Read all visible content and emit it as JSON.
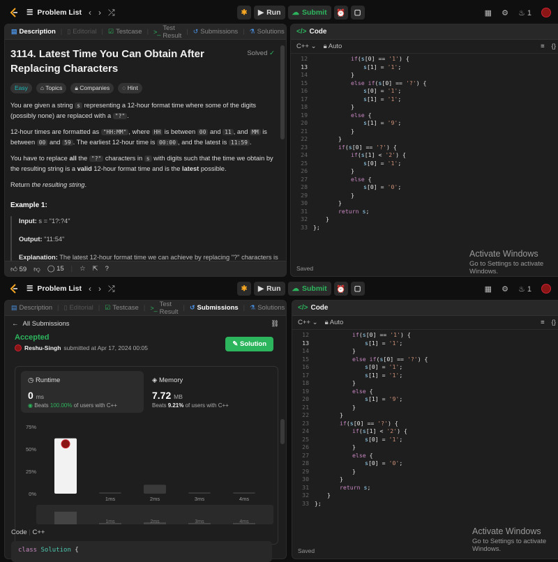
{
  "topbar": {
    "problem_list": "Problem List",
    "run": "Run",
    "submit": "Submit",
    "streak": "1"
  },
  "top_panel": {
    "tabs": [
      "Description",
      "Editorial",
      "Testcase",
      "Test Result",
      "Submissions",
      "Solutions"
    ],
    "title_line1": "3114. Latest Time You Can Obtain After",
    "title_line2": "Replacing Characters",
    "solved": "Solved",
    "chips": [
      "Easy",
      "Topics",
      "Companies",
      "Hint"
    ],
    "p1a": "You are given a string ",
    "p1code": "s",
    "p1b": " representing a 12-hour format time where some of the digits (possibly none) are replaced with a ",
    "p1code2": "\"?\"",
    "p1c": ".",
    "p2a": "12-hour times are formatted as ",
    "p2c1": "\"HH:MM\"",
    "p2b": ", where ",
    "p2c2": "HH",
    "p2c": " is between ",
    "p2c3": "00",
    "p2d": " and ",
    "p2c4": "11",
    "p2e": ", and ",
    "p2c5": "MM",
    "p2f": " is between ",
    "p2c6": "00",
    "p2g": " and ",
    "p2c7": "59",
    "p2h": ". The earliest 12-hour time is ",
    "p2c8": "00:00",
    "p2i": ", and the latest is ",
    "p2c9": "11:59",
    "p2j": ".",
    "p3a": "You have to replace ",
    "p3b": "all",
    "p3c": " the ",
    "p3code": "\"?\"",
    "p3d": " characters in ",
    "p3code2": "s",
    "p3e": " with digits such that the time we obtain by the resulting string is a ",
    "p3f": "valid",
    "p3g": " 12-hour format time and is the ",
    "p3h": "latest",
    "p3i": " possible.",
    "p4a": "Return ",
    "p4b": "the resulting string",
    "p4c": ".",
    "example_heading": "Example 1:",
    "input_label": "Input:",
    "input_value": "s = \"1?:?4\"",
    "output_label": "Output:",
    "output_value": "\"11:54\"",
    "explanation_label": "Explanation:",
    "explanation_value": "The latest 12-hour format time we can achieve by replacing \"?\" characters is",
    "likes": "59",
    "comments": "15"
  },
  "code_panel": {
    "title": "Code",
    "lang": "C++",
    "auto": "Auto",
    "saved": "Saved",
    "activate_title": "Activate Windows",
    "activate_sub": "Go to Settings to activate Windows."
  },
  "code_lines": [
    {
      "n": "12",
      "indent": 3,
      "html": "if(s[0] == '1') {"
    },
    {
      "n": "13",
      "indent": 4,
      "html": "s[1] = '1';"
    },
    {
      "n": "14",
      "indent": 3,
      "html": "}"
    },
    {
      "n": "15",
      "indent": 3,
      "html": "else if(s[0] == '?') {"
    },
    {
      "n": "16",
      "indent": 4,
      "html": "s[0] = '1';"
    },
    {
      "n": "17",
      "indent": 4,
      "html": "s[1] = '1';"
    },
    {
      "n": "18",
      "indent": 3,
      "html": "}"
    },
    {
      "n": "19",
      "indent": 3,
      "html": "else {"
    },
    {
      "n": "20",
      "indent": 4,
      "html": "s[1] = '9';"
    },
    {
      "n": "21",
      "indent": 3,
      "html": "}"
    },
    {
      "n": "22",
      "indent": 2,
      "html": "}"
    },
    {
      "n": "23",
      "indent": 2,
      "html": "if(s[0] == '?') {"
    },
    {
      "n": "24",
      "indent": 3,
      "html": "if(s[1] < '2') {"
    },
    {
      "n": "25",
      "indent": 4,
      "html": "s[0] = '1';"
    },
    {
      "n": "26",
      "indent": 3,
      "html": "}"
    },
    {
      "n": "27",
      "indent": 3,
      "html": "else {"
    },
    {
      "n": "28",
      "indent": 4,
      "html": "s[0] = '0';"
    },
    {
      "n": "29",
      "indent": 3,
      "html": "}"
    },
    {
      "n": "30",
      "indent": 2,
      "html": "}"
    },
    {
      "n": "31",
      "indent": 2,
      "html": "return s;"
    },
    {
      "n": "32",
      "indent": 1,
      "html": "}"
    },
    {
      "n": "33",
      "indent": 0,
      "html": "};"
    }
  ],
  "bottom_panel": {
    "tabs": [
      "Description",
      "Editorial",
      "Testcase",
      "Test Result",
      "Submissions",
      "Solutions"
    ],
    "all_submissions": "All Submissions",
    "accepted": "Accepted",
    "user": "Reshu-Singh",
    "submitted_at": "submitted at Apr 17, 2024 00:05",
    "solution_btn": "Solution",
    "runtime_label": "Runtime",
    "runtime_value": "0",
    "runtime_unit": "ms",
    "runtime_beats_a": "Beats ",
    "runtime_beats_pct": "100.00%",
    "runtime_beats_b": " of users with C++",
    "memory_label": "Memory",
    "memory_value": "7.72",
    "memory_unit": "MB",
    "memory_beats_a": "Beats ",
    "memory_beats_pct": "9.21%",
    "memory_beats_b": " of users with C++",
    "code_label": "Code",
    "code_lang": "C++",
    "code_first_line_kw": "class",
    "code_first_line_name": "Solution",
    "code_first_line_brace": " {"
  },
  "chart_data": {
    "type": "bar",
    "categories": [
      "0ms",
      "1ms",
      "2ms",
      "3ms",
      "4ms"
    ],
    "x_labels_shown": [
      "1ms",
      "2ms",
      "3ms",
      "4ms"
    ],
    "values": [
      62,
      1.5,
      10,
      1.5,
      1.5
    ],
    "ylim": [
      0,
      75
    ],
    "yticks": [
      "75%",
      "50%",
      "25%",
      "0%"
    ],
    "highlight_index": 0
  }
}
